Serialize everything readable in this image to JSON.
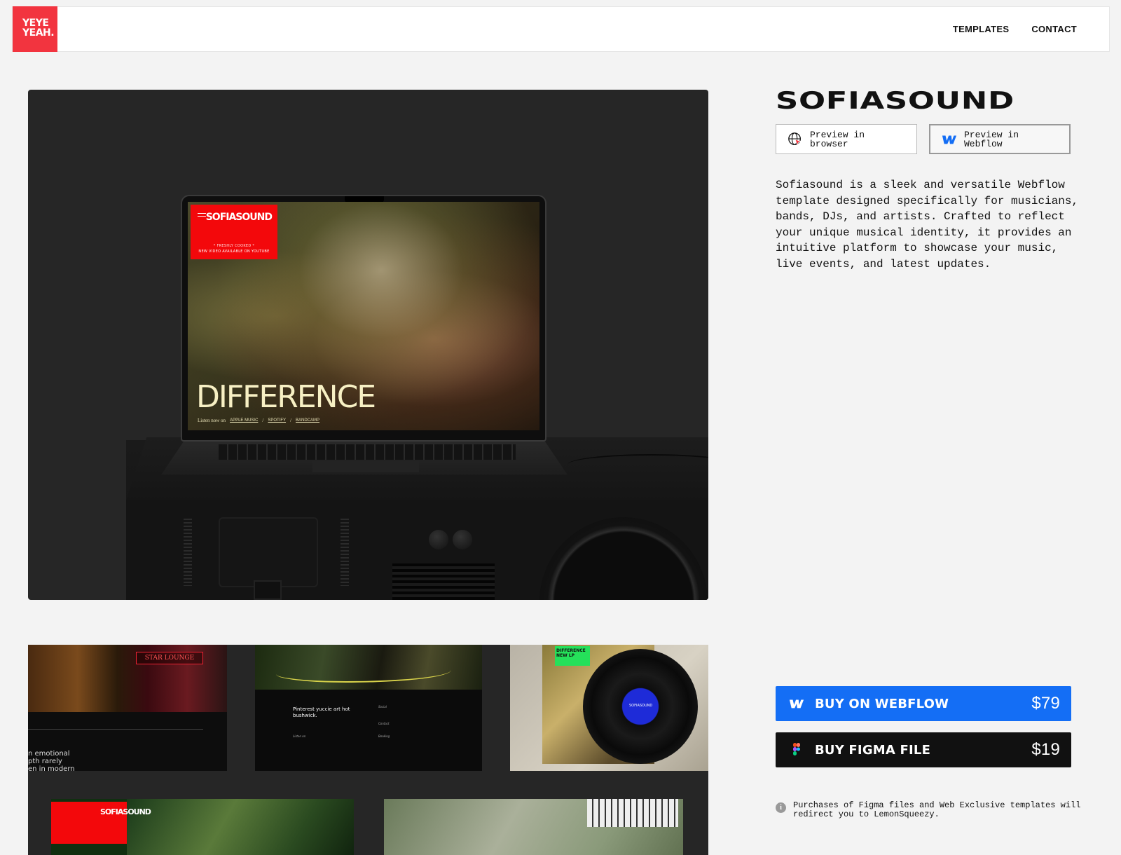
{
  "nav": {
    "logo_line1": "YEYE",
    "logo_line2": "YEAH.",
    "links": [
      {
        "label": "TEMPLATES"
      },
      {
        "label": "CONTACT"
      }
    ]
  },
  "hero_mockup": {
    "screen": {
      "brand": "SOFIASOUND",
      "promo_line1": "* FRESHLY COOKED *",
      "promo_line2": "NEW VIDEO AVAILABLE ON YOUTUBE",
      "headline": "DIFFERENCE",
      "listen_label": "Listen now on",
      "links": [
        "APPLE MUSIC",
        "SPOTIFY",
        "BANDCAMP"
      ],
      "separator": "/"
    }
  },
  "gallery": {
    "tile1": {
      "sign": "STAR LOUNGE",
      "text_lines": [
        "n emotional",
        "pth rarely",
        "en in modern"
      ]
    },
    "tile2": {
      "heading": "Pinterest yuccie art hot bushwick.",
      "social_label": "Social",
      "contact_label": "Contact",
      "booking_label": "Booking",
      "listen_label": "Listen on"
    },
    "tile3": {
      "sticker": "DIFFERENCE NEW LP",
      "vinyl_label": "SOFIASOUND"
    },
    "tile4": {
      "brand": "SOFIASOUND"
    }
  },
  "product": {
    "title": "SOFIASOUND",
    "preview_browser": "Preview in browser",
    "preview_webflow": "Preview in Webflow",
    "description": "Sofiasound is a sleek and versatile Webflow template designed specifically for musicians, bands, DJs, and artists. Crafted to reflect your unique musical identity, it provides an intuitive platform to showcase your music, live events, and latest updates.",
    "buy_webflow": {
      "label": "BUY ON WEBFLOW",
      "price": "$79"
    },
    "buy_figma": {
      "label": "BUY FIGMA FILE",
      "price": "$19"
    },
    "note": "Purchases of Figma files and Web Exclusive templates will redirect you to LemonSqueezy."
  },
  "colors": {
    "logo_red": "#f2343f",
    "webflow_blue": "#146ef5",
    "figma_black": "#111111",
    "background": "#f3f3f3"
  },
  "icons": [
    "globe-cursor-icon",
    "webflow-icon",
    "figma-icon",
    "info-icon",
    "hamburger-icon"
  ]
}
